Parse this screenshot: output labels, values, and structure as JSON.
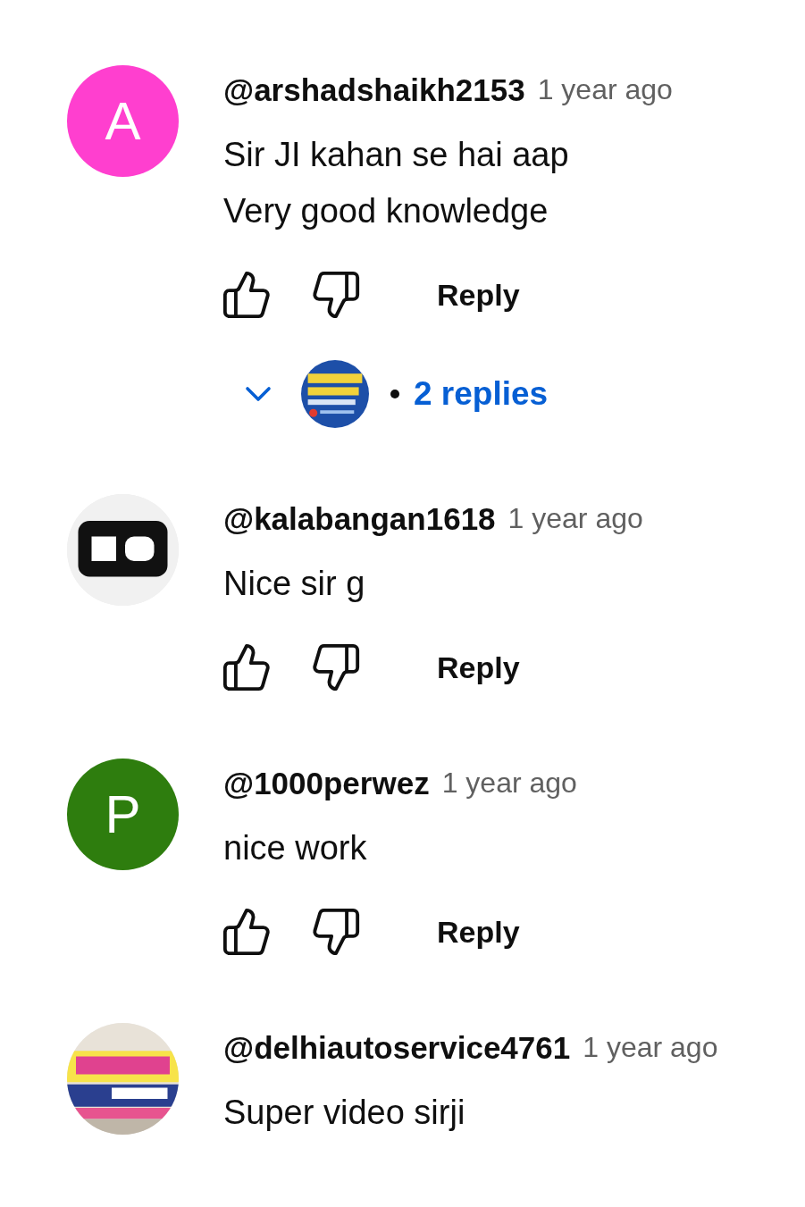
{
  "comments": [
    {
      "avatar": {
        "kind": "letter",
        "letter": "A",
        "color": "#ff3fcf"
      },
      "author": "@arshadshaikh2153",
      "time": "1 year ago",
      "lines": [
        "Sir JI kahan se hai aap",
        "Very good knowledge"
      ],
      "reply": "Reply",
      "replies": {
        "avatar": {
          "kind": "picture"
        },
        "label": "2 replies"
      }
    },
    {
      "avatar": {
        "kind": "picture"
      },
      "author": "@kalabangan1618",
      "time": "1 year ago",
      "lines": [
        "Nice sir g"
      ],
      "reply": "Reply"
    },
    {
      "avatar": {
        "kind": "letter",
        "letter": "P",
        "color": "#2e7d0e"
      },
      "author": "@1000perwez",
      "time": "1 year ago",
      "lines": [
        "nice work"
      ],
      "reply": "Reply"
    },
    {
      "avatar": {
        "kind": "picture"
      },
      "author": "@delhiautoservice4761",
      "time": "1 year ago",
      "lines": [
        "Super video sirji"
      ]
    }
  ]
}
